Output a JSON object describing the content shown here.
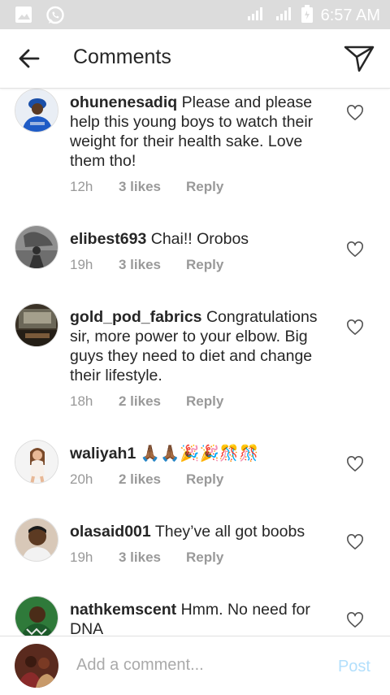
{
  "status_bar": {
    "time": "6:57 AM",
    "icons": [
      "image-icon",
      "whatsapp-icon",
      "signal-icon",
      "signal-icon",
      "battery-icon"
    ]
  },
  "header": {
    "title": "Comments",
    "back_icon": "arrow-left-icon",
    "direct_icon": "paper-plane-icon"
  },
  "comments": [
    {
      "username": "ohunenesadiq",
      "text": "Please and please help this young boys  to watch their weight for their health sake. Love them tho!",
      "time": "12h",
      "likes": "3 likes",
      "reply": "Reply"
    },
    {
      "username": "elibest693",
      "text": "Chai!! Orobos",
      "time": "19h",
      "likes": "3 likes",
      "reply": "Reply"
    },
    {
      "username": "gold_pod_fabrics",
      "text": "Congratulations sir, more power to your elbow.  Big guys they need to diet and change their lifestyle.",
      "time": "18h",
      "likes": "2 likes",
      "reply": "Reply"
    },
    {
      "username": "waliyah1",
      "text": "🙏🏾🙏🏾🎉🎉🎊🎊",
      "time": "20h",
      "likes": "2 likes",
      "reply": "Reply"
    },
    {
      "username": "olasaid001",
      "text": "They’ve all got boobs",
      "time": "19h",
      "likes": "3 likes",
      "reply": "Reply"
    },
    {
      "username": "nathkemscent",
      "text": "Hmm. No need for DNA",
      "time": "",
      "likes": "",
      "reply": ""
    }
  ],
  "composer": {
    "placeholder": "Add a comment...",
    "post_label": "Post"
  },
  "colors": {
    "text": "#262626",
    "meta": "#999999",
    "post_disabled": "#b2dffc",
    "status_bar": "#dcdcdc"
  }
}
